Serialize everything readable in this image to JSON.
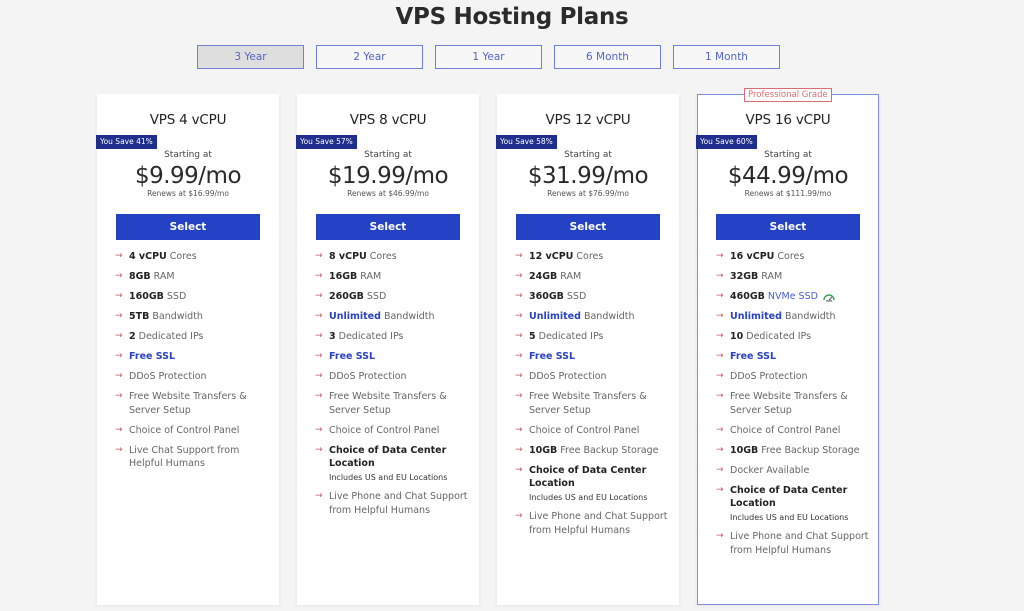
{
  "page": {
    "title": "VPS Hosting Plans"
  },
  "terms": [
    {
      "label": "3 Year",
      "active": true
    },
    {
      "label": "2 Year",
      "active": false
    },
    {
      "label": "1 Year",
      "active": false
    },
    {
      "label": "6 Month",
      "active": false
    },
    {
      "label": "1 Month",
      "active": false
    }
  ],
  "colors": {
    "accent": "#2342c4",
    "badge": "#1f2e8c",
    "arrow": "#c85a63",
    "featured_border": "#8191e0",
    "pro_tag": "#d66d76",
    "background": "#f4f4f4"
  },
  "plans": [
    {
      "name": "VPS 4 vCPU",
      "save_badge": "You Save 41%",
      "starting_label": "Starting at",
      "price": "$9.99/mo",
      "renews": "Renews at $16.99/mo",
      "select_label": "Select",
      "features": [
        {
          "strong": "4 vCPU",
          "text": " Cores"
        },
        {
          "strong": "8GB",
          "text": " RAM"
        },
        {
          "strong": "160GB",
          "text": " SSD"
        },
        {
          "strong": "5TB",
          "text": " Bandwidth"
        },
        {
          "strong": "2",
          "text": " Dedicated IPs"
        },
        {
          "blue": "Free SSL"
        },
        {
          "text": "DDoS Protection"
        },
        {
          "text": "Free Website Transfers & Server Setup"
        },
        {
          "text": "Choice of Control Panel"
        },
        {
          "text": "Live Chat Support from Helpful Humans"
        }
      ]
    },
    {
      "name": "VPS 8 vCPU",
      "save_badge": "You Save 57%",
      "starting_label": "Starting at",
      "price": "$19.99/mo",
      "renews": "Renews at $46.99/mo",
      "select_label": "Select",
      "features": [
        {
          "strong": "8 vCPU",
          "text": " Cores"
        },
        {
          "strong": "16GB",
          "text": " RAM"
        },
        {
          "strong": "260GB",
          "text": " SSD"
        },
        {
          "blue": "Unlimited",
          "text": " Bandwidth"
        },
        {
          "strong": "3",
          "text": " Dedicated IPs"
        },
        {
          "blue": "Free SSL"
        },
        {
          "text": "DDoS Protection"
        },
        {
          "text": "Free Website Transfers & Server Setup"
        },
        {
          "text": "Choice of Control Panel"
        },
        {
          "strong": "Choice of Data Center Location",
          "sub": "Includes US and EU Locations"
        },
        {
          "text": "Live Phone and Chat Support from Helpful Humans"
        }
      ]
    },
    {
      "name": "VPS 12 vCPU",
      "save_badge": "You Save 58%",
      "starting_label": "Starting at",
      "price": "$31.99/mo",
      "renews": "Renews at $76.99/mo",
      "select_label": "Select",
      "features": [
        {
          "strong": "12 vCPU",
          "text": " Cores"
        },
        {
          "strong": "24GB",
          "text": " RAM"
        },
        {
          "strong": "360GB",
          "text": " SSD"
        },
        {
          "blue": "Unlimited",
          "text": " Bandwidth"
        },
        {
          "strong": "5",
          "text": " Dedicated IPs"
        },
        {
          "blue": "Free SSL"
        },
        {
          "text": "DDoS Protection"
        },
        {
          "text": "Free Website Transfers & Server Setup"
        },
        {
          "text": "Choice of Control Panel"
        },
        {
          "strong": "10GB",
          "text": " Free Backup Storage"
        },
        {
          "strong": "Choice of Data Center Location",
          "sub": "Includes US and EU Locations"
        },
        {
          "text": "Live Phone and Chat Support from Helpful Humans"
        }
      ]
    },
    {
      "name": "VPS 16 vCPU",
      "featured_tag": "Professional Grade",
      "save_badge": "You Save 60%",
      "starting_label": "Starting at",
      "price": "$44.99/mo",
      "renews": "Renews at $111.99/mo",
      "select_label": "Select",
      "features": [
        {
          "strong": "16 vCPU",
          "text": " Cores"
        },
        {
          "strong": "32GB",
          "text": " RAM"
        },
        {
          "strong": "460GB",
          "bluelight": " NVMe SSD",
          "icon": "speed-gauge-icon"
        },
        {
          "blue": "Unlimited",
          "text": " Bandwidth"
        },
        {
          "strong": "10",
          "text": " Dedicated IPs"
        },
        {
          "blue": "Free SSL"
        },
        {
          "text": "DDoS Protection"
        },
        {
          "text": "Free Website Transfers & Server Setup"
        },
        {
          "text": "Choice of Control Panel"
        },
        {
          "strong": "10GB",
          "text": " Free Backup Storage"
        },
        {
          "text": "Docker Available"
        },
        {
          "strong": "Choice of Data Center Location",
          "sub": "Includes US and EU Locations"
        },
        {
          "text": "Live Phone and Chat Support from Helpful Humans"
        }
      ]
    }
  ],
  "icons": {
    "feature_bullet": "arrow-right-icon",
    "arrow_glyph": "→"
  }
}
